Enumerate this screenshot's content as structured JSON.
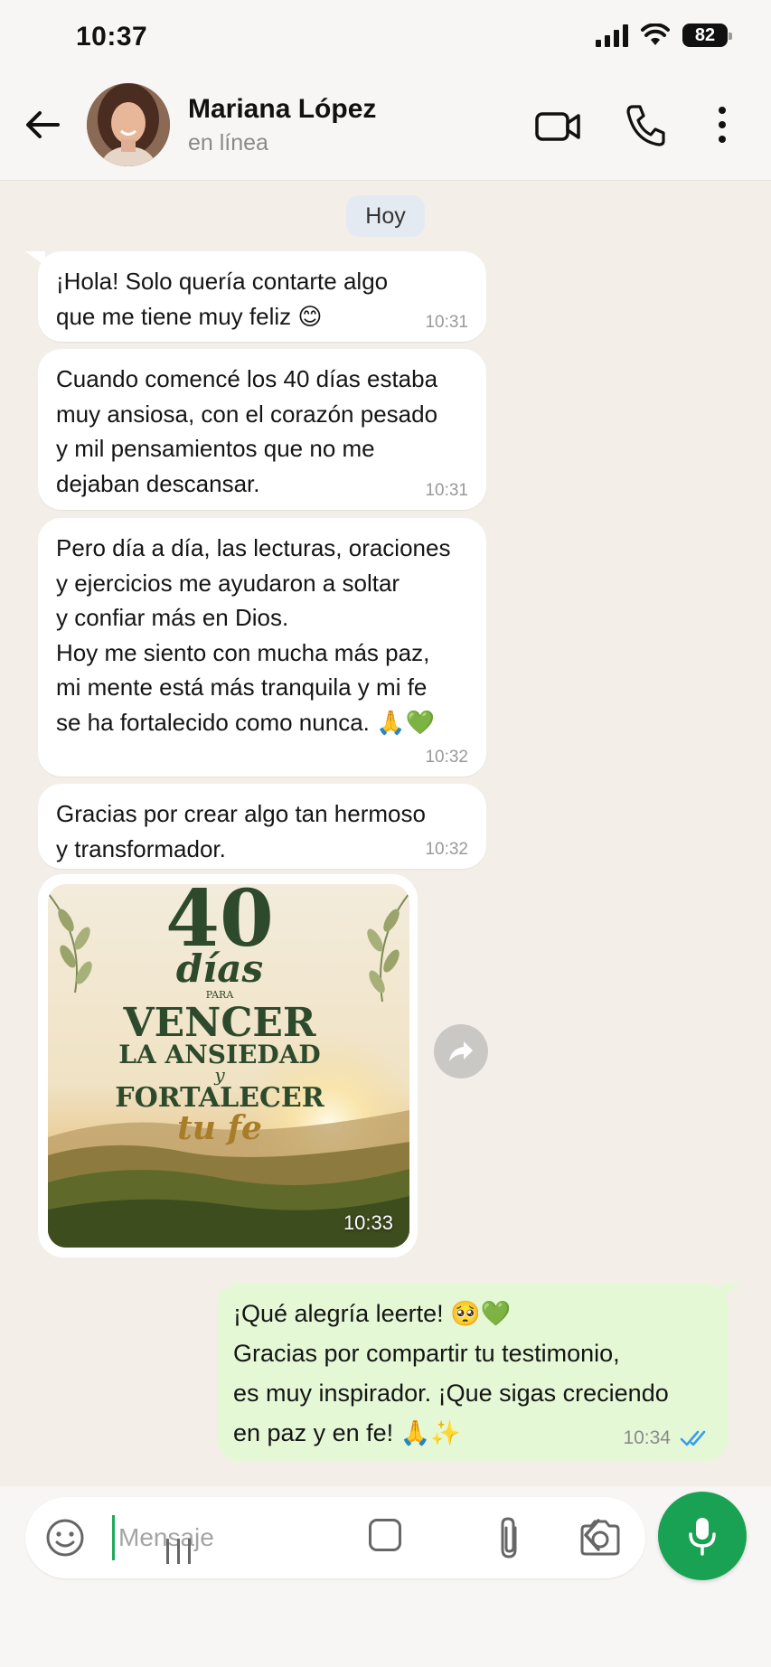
{
  "status_bar": {
    "time": "10:37",
    "battery": "82"
  },
  "header": {
    "contact_name": "Mariana López",
    "contact_status": "en línea",
    "icons": [
      "back-arrow-icon",
      "video-call-icon",
      "phone-icon",
      "more-vertical-icon"
    ]
  },
  "chat": {
    "date_chip": "Hoy",
    "messages": [
      {
        "text": "¡Hola! Solo quería contarte algo\nque me tiene muy feliz 😊",
        "time": "10:31"
      },
      {
        "text": "Cuando comencé los 40 días estaba\nmuy ansiosa, con el corazón pesado\ny mil pensamientos que no me\ndejaban descansar.",
        "time": "10:31"
      },
      {
        "text": "Pero día a día, las lecturas, oraciones\ny ejercicios me ayudaron a soltar\ny confiar más en Dios.\nHoy me siento con mucha más paz,\nmi mente está más tranquila y mi fe\nse ha fortalecido como nunca. 🙏💚",
        "time": "10:32"
      },
      {
        "text": "Gracias por crear algo tan hermoso\ny transformador.",
        "time": "10:32"
      }
    ],
    "image_message": {
      "title_number": "40",
      "title_word": "días",
      "small_word": "PARA",
      "line1": "VENCER",
      "line2": "LA ANSIEDAD",
      "connector": "y",
      "line3": "FORTALECER",
      "line4": "tu fe",
      "time": "10:33"
    },
    "outgoing": {
      "text": "¡Qué alegría leerte! 🥺💚\nGracias por compartir tu testimonio,\nes muy inspirador. ¡Que sigas creciendo\nen paz y en fe! 🙏✨",
      "time": "10:34",
      "status": "read"
    }
  },
  "input": {
    "placeholder": "Mensaje"
  },
  "colors": {
    "accent_green": "#1aa254",
    "outgoing_bubble": "#e4f8d6",
    "read_ticks": "#3a9bf0"
  }
}
